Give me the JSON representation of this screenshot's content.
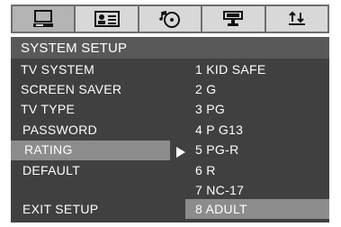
{
  "tabs": [
    {
      "icon": "monitor-icon",
      "active": true
    },
    {
      "icon": "id-card-icon",
      "active": false
    },
    {
      "icon": "music-disc-icon",
      "active": false
    },
    {
      "icon": "speaker-icon",
      "active": false
    },
    {
      "icon": "equalizer-icon",
      "active": false
    }
  ],
  "title": "SYSTEM SETUP",
  "menu": {
    "tv_system": "TV SYSTEM",
    "screen_saver": "SCREEN SAVER",
    "tv_type": "TV TYPE",
    "password": "PASSWORD",
    "rating": "RATING",
    "default": "DEFAULT",
    "exit_setup": "EXIT SETUP"
  },
  "options": {
    "o1": "1 KID SAFE",
    "o2": "2 G",
    "o3": "3 PG",
    "o4": "4 P G13",
    "o5": "5 PG-R",
    "o6": "6 R",
    "o7": "7 NC-17",
    "o8": "8 ADULT"
  },
  "colors": {
    "panel": "#404040",
    "title_bar": "#595959",
    "highlight": "#8c8c8c",
    "text": "#ffffff"
  }
}
